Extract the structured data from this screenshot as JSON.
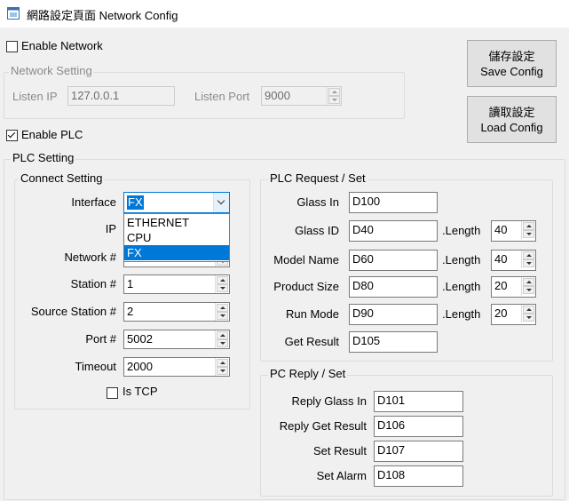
{
  "window": {
    "title": "網路設定頁面 Network Config"
  },
  "network": {
    "enable_label": "Enable Network",
    "enabled": false,
    "group_title": "Network Setting",
    "listen_ip_label": "Listen IP",
    "listen_ip_value": "127.0.0.1",
    "listen_port_label": "Listen Port",
    "listen_port_value": "9000"
  },
  "buttons": {
    "save_zh": "儲存設定",
    "save_en": "Save Config",
    "load_zh": "讀取設定",
    "load_en": "Load Config"
  },
  "plc": {
    "enable_label": "Enable PLC",
    "enabled": true,
    "group_title": "PLC Setting",
    "connect": {
      "title": "Connect Setting",
      "interface_label": "Interface",
      "interface_value": "FX",
      "interface_options": [
        "ETHERNET",
        "CPU",
        "FX"
      ],
      "ip_label": "IP",
      "network_label": "Network #",
      "station_label": "Station #",
      "station_value": "1",
      "source_station_label": "Source Station #",
      "source_station_value": "2",
      "port_label": "Port #",
      "port_value": "5002",
      "timeout_label": "Timeout",
      "timeout_value": "2000",
      "is_tcp_label": "Is TCP",
      "is_tcp": false
    },
    "request": {
      "title": "PLC Request / Set",
      "length_label": ".Length",
      "glass_in_label": "Glass In",
      "glass_in_value": "D100",
      "glass_id_label": "Glass ID",
      "glass_id_value": "D40",
      "glass_id_length": "40",
      "model_name_label": "Model Name",
      "model_name_value": "D60",
      "model_name_length": "40",
      "product_size_label": "Product Size",
      "product_size_value": "D80",
      "product_size_length": "20",
      "run_mode_label": "Run Mode",
      "run_mode_value": "D90",
      "run_mode_length": "20",
      "get_result_label": "Get Result",
      "get_result_value": "D105"
    },
    "reply": {
      "title": "PC Reply / Set",
      "reply_glass_in_label": "Reply Glass In",
      "reply_glass_in_value": "D101",
      "reply_get_result_label": "Reply Get Result",
      "reply_get_result_value": "D106",
      "set_result_label": "Set Result",
      "set_result_value": "D107",
      "set_alarm_label": "Set Alarm",
      "set_alarm_value": "D108"
    }
  }
}
